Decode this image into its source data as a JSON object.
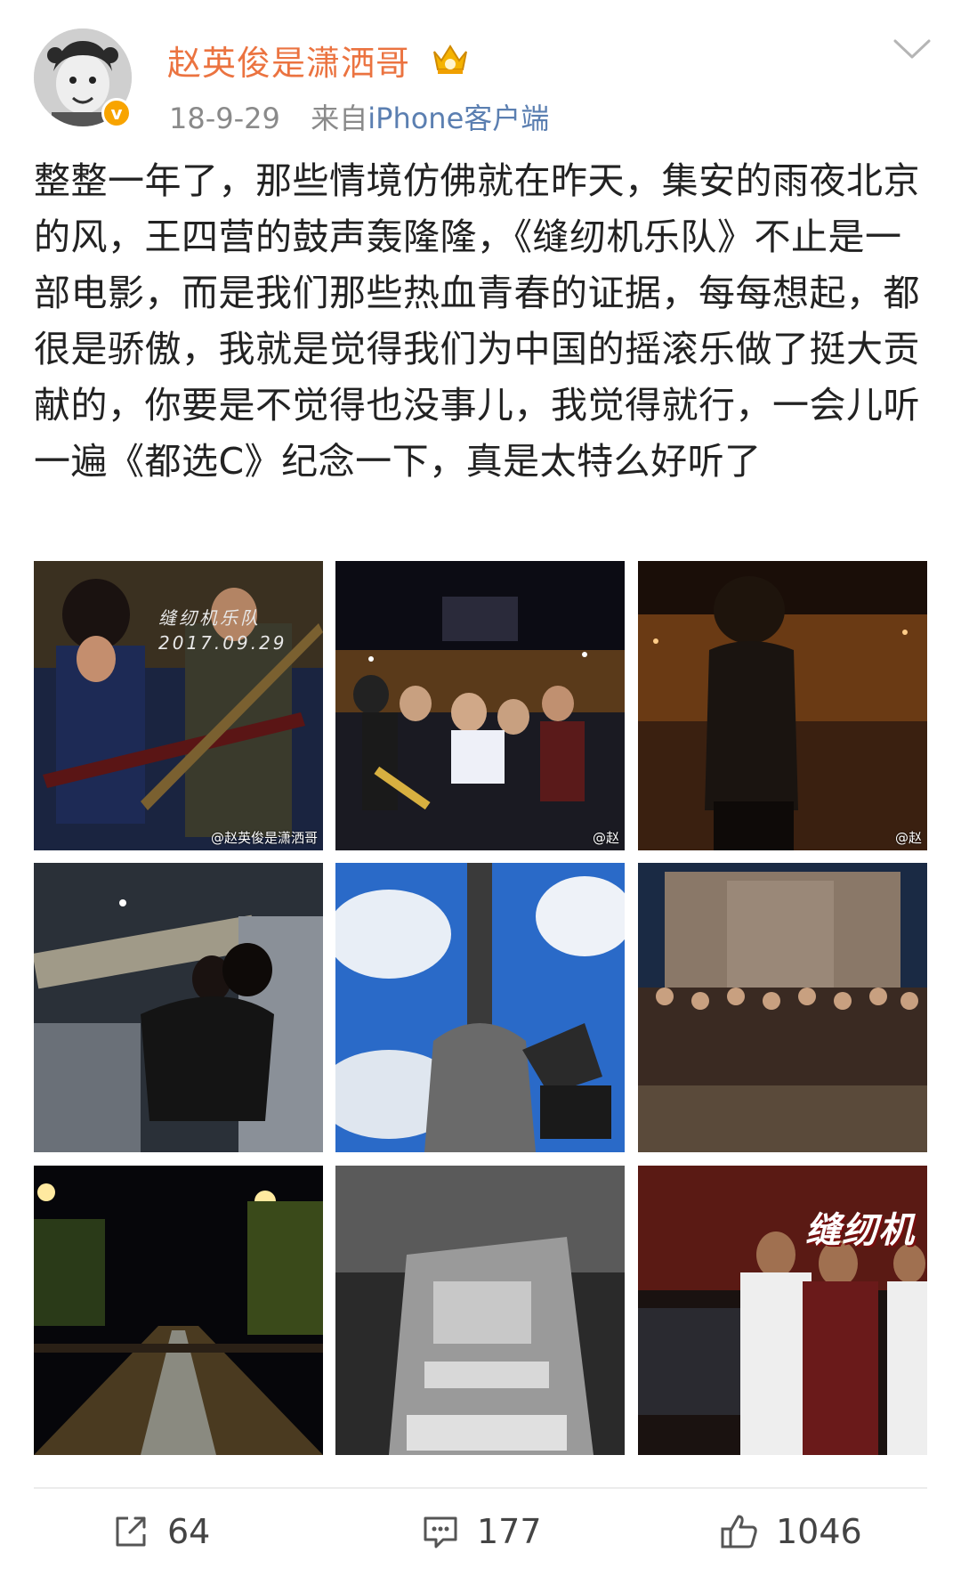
{
  "post": {
    "username": "赵英俊是潇洒哥",
    "date": "18-9-29",
    "source_prefix": "来自",
    "source_device": "iPhone客户端",
    "text": "整整一年了，那些情境仿佛就在昨天，集安的雨夜北京的风，王四营的鼓声轰隆隆，《缝纫机乐队》不止是一部电影，而是我们那些热血青春的证据，每每想起，都很是骄傲，我就是觉得我们为中国的摇滚乐做了挺大贡献的，你要是不觉得也没事儿，我觉得就行，一会儿听一遍《都选C》纪念一下，真是太特么好听了"
  },
  "photos": {
    "p1_handwriting_line1": "缝纫机乐队",
    "p1_handwriting_line2": "2017.09.29",
    "p1_watermark": "@赵英俊是潇洒哥",
    "p2_watermark": "@赵",
    "p3_watermark": "@赵",
    "p9_title_art": "缝纫机"
  },
  "actions": {
    "repost_count": "64",
    "comment_count": "177",
    "like_count": "1046"
  },
  "colors": {
    "username": "#eb7340",
    "source_link": "#5b7fb1",
    "meta": "#8a8a8a",
    "verified": "#f8a400"
  }
}
